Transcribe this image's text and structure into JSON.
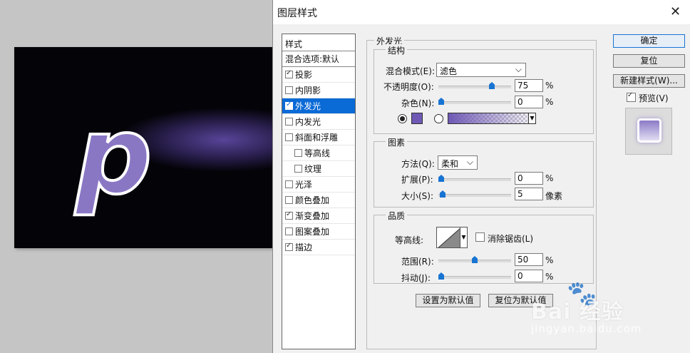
{
  "canvas": {
    "glyph": "p"
  },
  "dialog": {
    "title": "图层样式",
    "close_glyph": "✕",
    "styles_header": "样式",
    "styles": [
      {
        "label": "混合选项:默认",
        "checkbox": false,
        "checked": false,
        "selected": false,
        "indent": false
      },
      {
        "label": "投影",
        "checkbox": true,
        "checked": true,
        "selected": false,
        "indent": false
      },
      {
        "label": "内阴影",
        "checkbox": true,
        "checked": false,
        "selected": false,
        "indent": false
      },
      {
        "label": "外发光",
        "checkbox": true,
        "checked": true,
        "selected": true,
        "indent": false
      },
      {
        "label": "内发光",
        "checkbox": true,
        "checked": false,
        "selected": false,
        "indent": false
      },
      {
        "label": "斜面和浮雕",
        "checkbox": true,
        "checked": false,
        "selected": false,
        "indent": false
      },
      {
        "label": "等高线",
        "checkbox": true,
        "checked": false,
        "selected": false,
        "indent": true
      },
      {
        "label": "纹理",
        "checkbox": true,
        "checked": false,
        "selected": false,
        "indent": true
      },
      {
        "label": "光泽",
        "checkbox": true,
        "checked": false,
        "selected": false,
        "indent": false
      },
      {
        "label": "颜色叠加",
        "checkbox": true,
        "checked": false,
        "selected": false,
        "indent": false
      },
      {
        "label": "渐变叠加",
        "checkbox": true,
        "checked": true,
        "selected": false,
        "indent": false
      },
      {
        "label": "图案叠加",
        "checkbox": true,
        "checked": false,
        "selected": false,
        "indent": false
      },
      {
        "label": "描边",
        "checkbox": true,
        "checked": true,
        "selected": false,
        "indent": false
      }
    ],
    "panel_title": "外发光",
    "structure": {
      "title": "结构",
      "blend_mode_label": "混合模式(E):",
      "blend_mode_value": "滤色",
      "opacity_label": "不透明度(O):",
      "opacity_value": "75",
      "opacity_fraction": 0.75,
      "noise_label": "杂色(N):",
      "noise_value": "0",
      "noise_fraction": 0,
      "percent": "%",
      "glow_color": "#6f59b5"
    },
    "elements": {
      "title": "图素",
      "technique_label": "方法(Q):",
      "technique_value": "柔和",
      "spread_label": "扩展(P):",
      "spread_value": "0",
      "spread_fraction": 0,
      "size_label": "大小(S):",
      "size_value": "5",
      "size_fraction": 0.02,
      "size_unit": "像素",
      "percent": "%"
    },
    "quality": {
      "title": "品质",
      "contour_label": "等高线:",
      "antialias_label": "消除锯齿(L)",
      "range_label": "范围(R):",
      "range_value": "50",
      "range_fraction": 0.5,
      "jitter_label": "抖动(J):",
      "jitter_value": "0",
      "jitter_fraction": 0,
      "percent": "%"
    },
    "set_default_label": "设置为默认值",
    "reset_default_label": "复位为默认值",
    "ok_label": "确定",
    "reset_label": "复位",
    "new_style_label": "新建样式(W)...",
    "preview_label": "预览(V)"
  },
  "watermark": {
    "brand": "Bai 经验",
    "url": "jingyan.baidu.com"
  }
}
